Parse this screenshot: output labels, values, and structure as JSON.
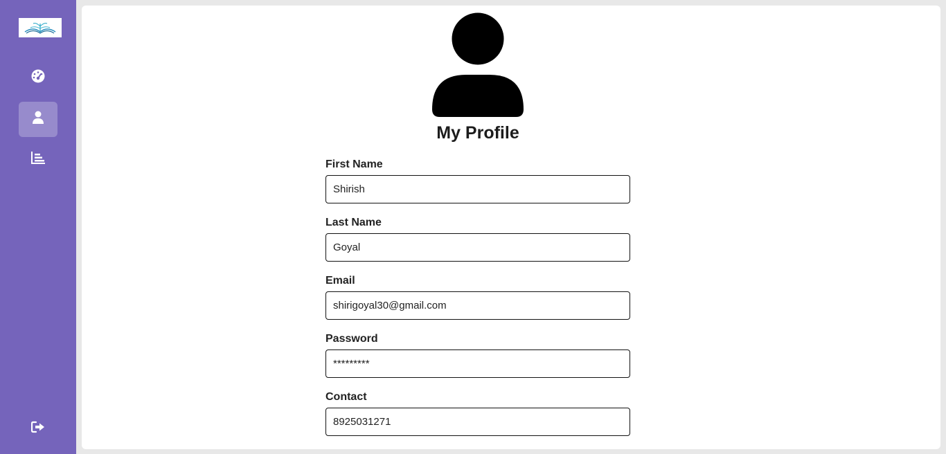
{
  "sidebar": {
    "logo": "book-logo",
    "items": [
      {
        "id": "dashboard",
        "icon": "dashboard-gauge-icon",
        "active": false
      },
      {
        "id": "profile",
        "icon": "user-icon",
        "active": true
      },
      {
        "id": "reports",
        "icon": "bar-chart-icon",
        "active": false
      }
    ],
    "logout_icon": "logout-icon"
  },
  "profile": {
    "avatar_icon": "user-avatar-icon",
    "title": "My Profile",
    "fields": [
      {
        "label": "First Name",
        "value": "Shirish"
      },
      {
        "label": "Last Name",
        "value": "Goyal"
      },
      {
        "label": "Email",
        "value": "shirigoyal30@gmail.com"
      },
      {
        "label": "Password",
        "value": "*********"
      },
      {
        "label": "Contact",
        "value": "8925031271"
      }
    ]
  },
  "colors": {
    "sidebar_bg": "#7564bb",
    "page_bg": "#e8e8e8",
    "card_bg": "#ffffff"
  }
}
